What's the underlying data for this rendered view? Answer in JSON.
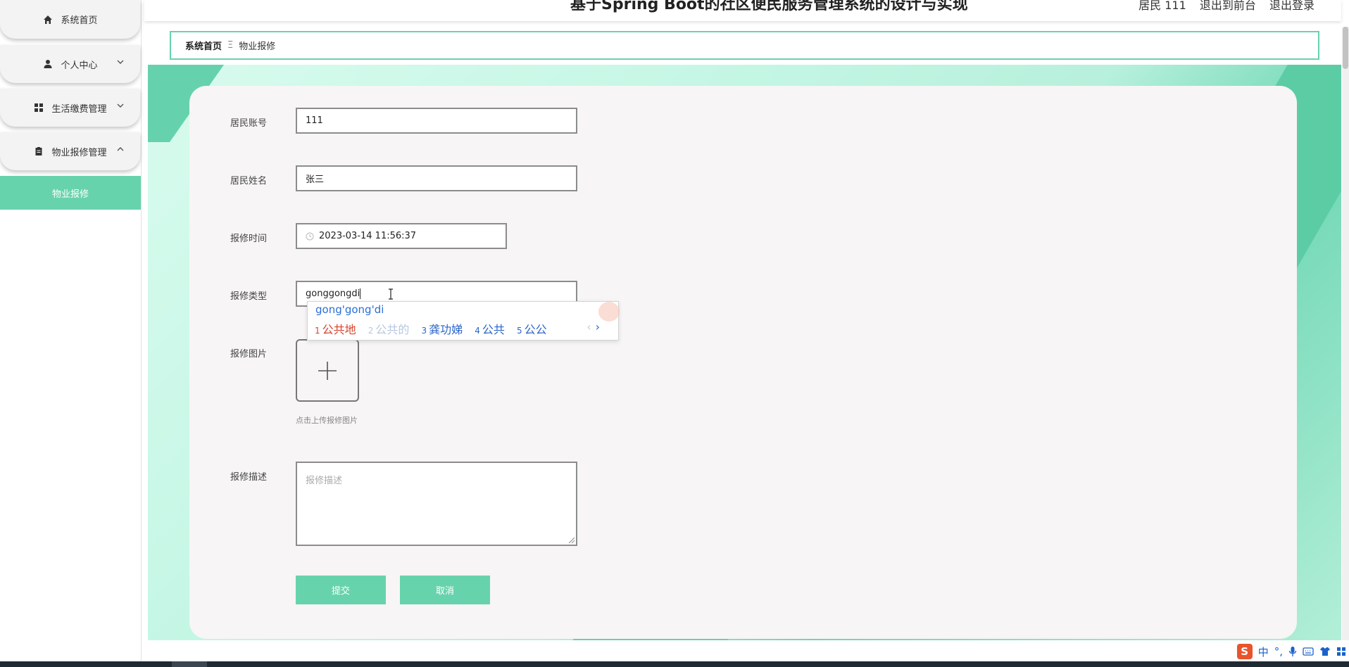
{
  "header": {
    "title": "基于Spring Boot的社区便民服务管理系统的设计与实现",
    "links": [
      "居民 111",
      "退出到前台",
      "退出登录"
    ]
  },
  "sidebar": {
    "items": [
      {
        "label": "系统首页",
        "icon": "home-icon"
      },
      {
        "label": "个人中心",
        "icon": "user-icon"
      },
      {
        "label": "生活缴费管理",
        "icon": "grid-icon"
      },
      {
        "label": "物业报修管理",
        "icon": "clipboard-icon"
      }
    ],
    "active_sub": "物业报修"
  },
  "breadcrumb": {
    "home": "系统首页",
    "sep": "Ξ",
    "current": "物业报修"
  },
  "form": {
    "account_label": "居民账号",
    "account_value": "111",
    "name_label": "居民姓名",
    "name_value": "张三",
    "time_label": "报修时间",
    "time_value": "2023-03-14 11:56:37",
    "type_label": "报修类型",
    "type_value": "gonggongdi",
    "image_label": "报修图片",
    "upload_hint": "点击上传报修图片",
    "desc_label": "报修描述",
    "desc_placeholder": "报修描述",
    "submit_label": "提交",
    "cancel_label": "取消"
  },
  "ime": {
    "composition": "gong'gong'di",
    "candidates": [
      {
        "num": "1",
        "text": "公共地"
      },
      {
        "num": "2",
        "text": "公共的"
      },
      {
        "num": "3",
        "text": "龚功娣"
      },
      {
        "num": "4",
        "text": "公共"
      },
      {
        "num": "5",
        "text": "公公"
      }
    ],
    "next": "›"
  },
  "tray": {
    "ime_mode": "中",
    "punct": "°,"
  },
  "colors": {
    "accent": "#67d3ad",
    "ime_blue": "#2b66c9",
    "ime_red": "#d8432b"
  }
}
